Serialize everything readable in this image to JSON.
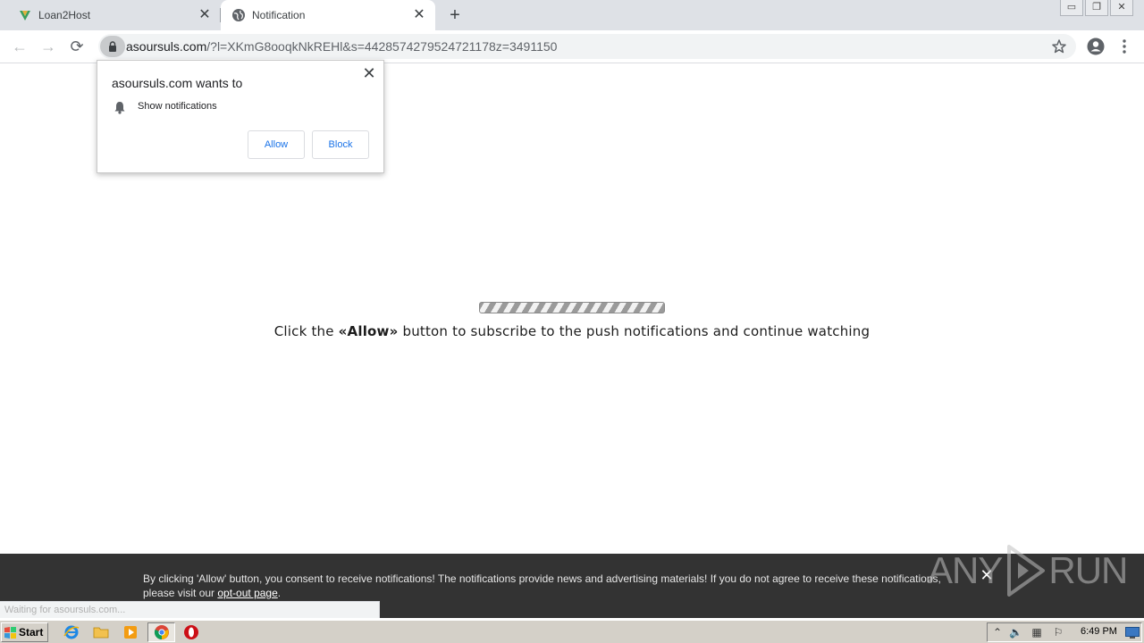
{
  "browser": {
    "tabs": [
      {
        "title": "Loan2Host",
        "active": false,
        "icon": "loan2host-favicon"
      },
      {
        "title": "Notification",
        "active": true,
        "icon": "globe-icon"
      }
    ],
    "new_tab_label": "+",
    "window_controls": {
      "minimize": "▭",
      "restore": "❐",
      "close": "✕"
    },
    "url_host": "asoursuls.com",
    "url_rest": "/?l=XKmG8ooqkNkREHl&s=4428574279524721178z=3491150",
    "status_bubble": "Waiting for asoursuls.com..."
  },
  "permission_prompt": {
    "title": "asoursuls.com wants to",
    "item": "Show notifications",
    "allow_label": "Allow",
    "block_label": "Block",
    "close_label": "✕"
  },
  "page": {
    "cta_before": "Click the ",
    "cta_bold": "«Allow»",
    "cta_after": " button to subscribe to the push notifications and continue watching"
  },
  "consent_bar": {
    "text": "By clicking 'Allow' button, you consent to receive notifications! The notifications provide news and advertising materials! If you do not agree to receive these notifications, please visit our ",
    "link": "opt-out page",
    "end": ".",
    "close_label": "✕"
  },
  "watermark": {
    "text": "ANY",
    "text2": "RUN"
  },
  "taskbar": {
    "start_label": "Start",
    "clock": "6:49 PM",
    "pinned": [
      "internet-explorer-icon",
      "folder-icon",
      "media-player-icon",
      "chrome-icon",
      "opera-icon"
    ]
  },
  "colors": {
    "tabstrip": "#dee1e6",
    "accent_blue": "#1a73e8",
    "consent_bg": "#333333",
    "taskbar": "#d4d0c8"
  }
}
